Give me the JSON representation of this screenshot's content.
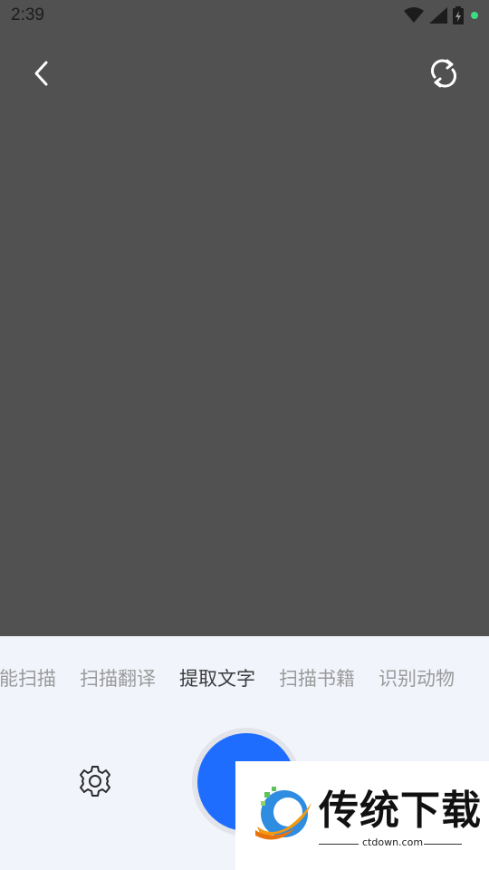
{
  "status_bar": {
    "time": "2:39",
    "icons": [
      "wifi-icon",
      "cellular-signal-icon",
      "battery-charging-icon",
      "notification-dot-icon"
    ],
    "dot_color": "#3ddc84"
  },
  "camera": {
    "background": "#515151",
    "back_icon": "chevron-left-icon",
    "switch_icon": "camera-switch-icon"
  },
  "modes": {
    "items": [
      {
        "label": "智能扫描"
      },
      {
        "label": "扫描翻译"
      },
      {
        "label": "提取文字"
      },
      {
        "label": "扫描书籍"
      },
      {
        "label": "识别动物"
      }
    ],
    "active_index": 2
  },
  "controls": {
    "settings_icon": "gear-icon",
    "shutter_color": "#1f6dff"
  },
  "watermark": {
    "title": "传统下载",
    "domain": "ctdown.com"
  }
}
